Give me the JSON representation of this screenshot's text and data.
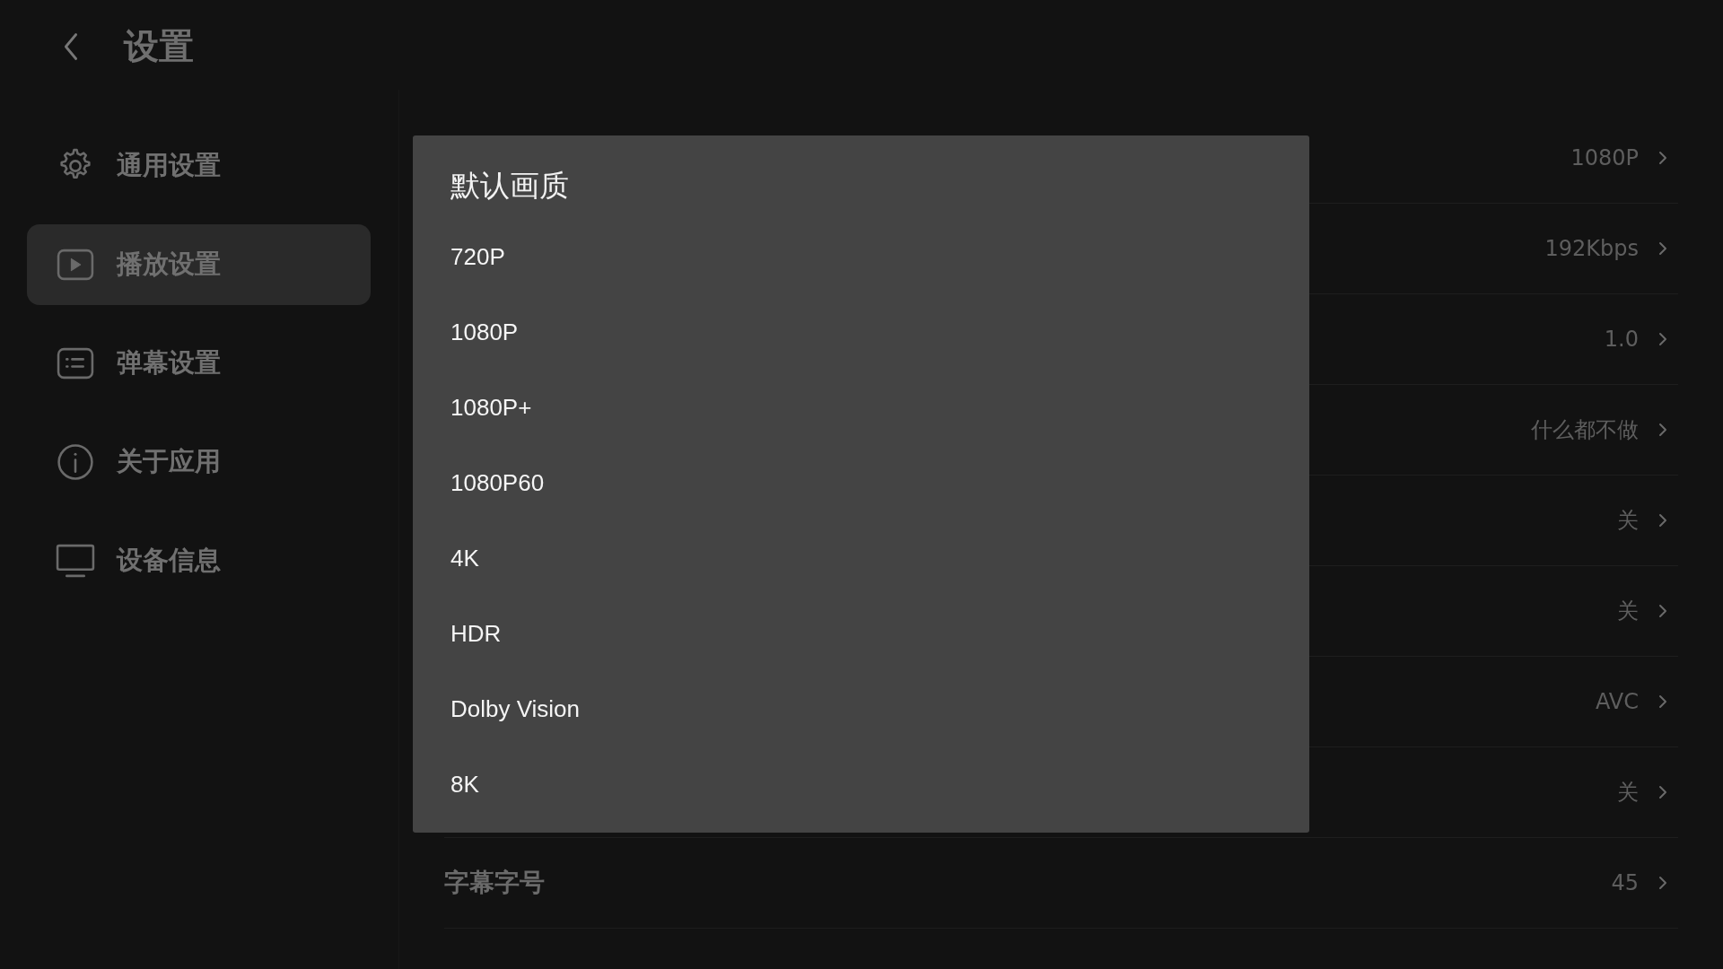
{
  "header": {
    "title": "设置"
  },
  "sidebar": {
    "items": [
      {
        "label": "通用设置",
        "kind": "general",
        "selected": false
      },
      {
        "label": "播放设置",
        "kind": "playback",
        "selected": true
      },
      {
        "label": "弹幕设置",
        "kind": "danmaku",
        "selected": false
      },
      {
        "label": "关于应用",
        "kind": "about",
        "selected": false
      },
      {
        "label": "设备信息",
        "kind": "device",
        "selected": false
      }
    ]
  },
  "settings": [
    {
      "value": "1080P"
    },
    {
      "value": "192Kbps"
    },
    {
      "value": "1.0"
    },
    {
      "value": "什么都不做"
    },
    {
      "value": "关"
    },
    {
      "value": "关"
    },
    {
      "value": "AVC"
    },
    {
      "value": "关"
    },
    {
      "label": "字幕字号",
      "value": "45"
    }
  ],
  "dialog": {
    "title": "默认画质",
    "options": [
      "720P",
      "1080P",
      "1080P+",
      "1080P60",
      "4K",
      "HDR",
      "Dolby Vision",
      "8K"
    ]
  }
}
